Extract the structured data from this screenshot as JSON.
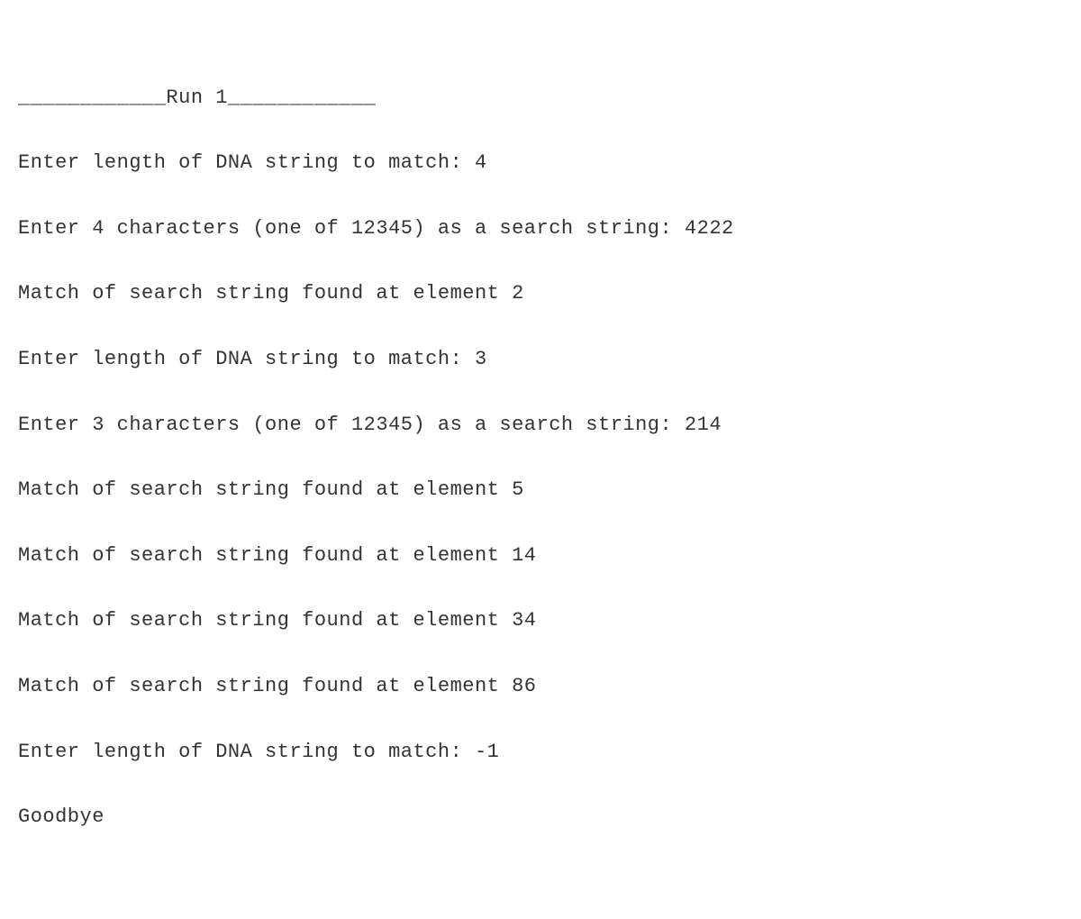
{
  "lines": {
    "l0": "____________Run 1____________",
    "l1": "Enter length of DNA string to match: 4",
    "l2": "Enter 4 characters (one of 12345) as a search string: 4222",
    "l3": "Match of search string found at element 2",
    "l4": "Enter length of DNA string to match: 3",
    "l5": "Enter 3 characters (one of 12345) as a search string: 214",
    "l6": "Match of search string found at element 5",
    "l7": "Match of search string found at element 14",
    "l8": "Match of search string found at element 34",
    "l9": "Match of search string found at element 86",
    "l10": "Enter length of DNA string to match: -1",
    "l11": "Goodbye"
  }
}
